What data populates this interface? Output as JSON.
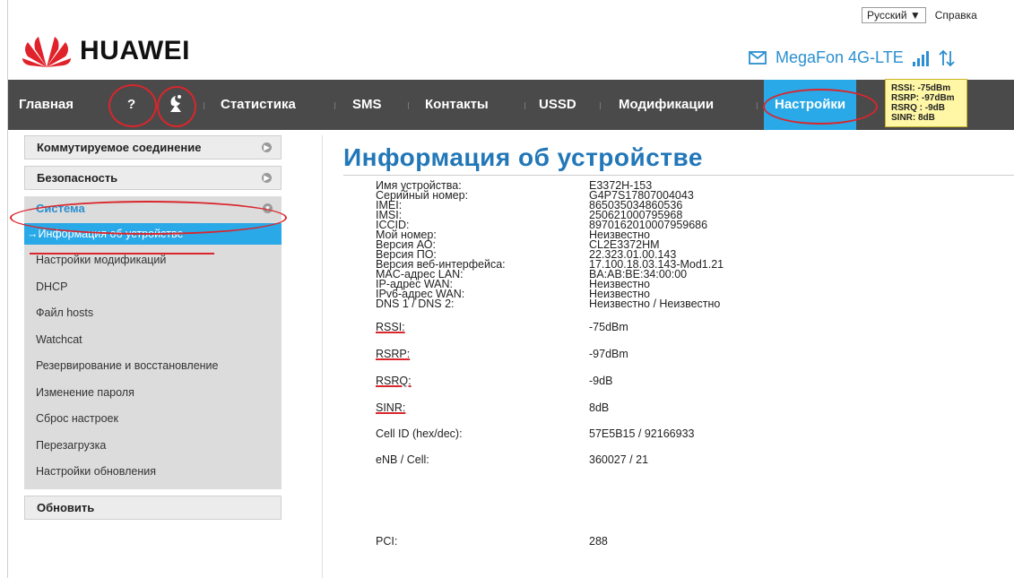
{
  "header": {
    "language": "Русский ▼",
    "help": "Справка",
    "logo_text": "HUAWEI",
    "operator": "MegaFon 4G-LTE",
    "colors": {
      "accent": "#29a9e8",
      "nav_bg": "#4a4a4a",
      "annotation": "#d9262c",
      "title": "#2277b8"
    }
  },
  "nav": {
    "items": [
      "Главная",
      "?",
      "Статистика",
      "SMS",
      "Контакты",
      "USSD",
      "Модификации",
      "Настройки"
    ],
    "active": "Настройки"
  },
  "tooltip": {
    "lines": [
      "RSSI: -75dBm",
      "RSRP: -97dBm",
      "RSRQ : -9dB",
      "SINR: 8dB"
    ]
  },
  "sidebar": {
    "dialup": "Коммутируемое соединение",
    "security": "Безопасность",
    "system": "Система",
    "system_items": [
      "→Информация об устройстве",
      "Настройки модификаций",
      "DHCP",
      "Файл hosts",
      "Watchcat",
      "Резервирование и восстановление",
      "Изменение пароля",
      "Сброс настроек",
      "Перезагрузка",
      "Настройки обновления"
    ],
    "update": "Обновить"
  },
  "content": {
    "title": "Информация об устройстве",
    "rows": [
      {
        "label": "Имя устройства:",
        "value": "E3372H-153"
      },
      {
        "label": "Серийный номер:",
        "value": "G4P7S17807004043"
      },
      {
        "label": "IMEI:",
        "value": "865035034860536"
      },
      {
        "label": "IMSI:",
        "value": "250621000795968"
      },
      {
        "label": "ICCID:",
        "value": "8970162010007959686"
      },
      {
        "label": "Мой номер:",
        "value": "Неизвестно"
      },
      {
        "label": "Версия АО:",
        "value": "CL2E3372HM"
      },
      {
        "label": "Версия ПО:",
        "value": "22.323.01.00.143"
      },
      {
        "label": "Версия веб-интерфейса:",
        "value": "17.100.18.03.143-Mod1.21"
      },
      {
        "label": "MAC-адрес LAN:",
        "value": "BA:AB:BE:34:00:00"
      },
      {
        "label": "IP-адрес WAN:",
        "value": "Неизвестно"
      },
      {
        "label": "IPv6-адрес WAN:",
        "value": "Неизвестно"
      },
      {
        "label": "DNS 1 / DNS 2:",
        "value": "Неизвестно / Неизвестно"
      },
      {
        "label": "RSSI:",
        "value": "-75dBm"
      },
      {
        "label": "RSRP:",
        "value": "-97dBm"
      },
      {
        "label": "RSRQ:",
        "value": "-9dB"
      },
      {
        "label": "SINR:",
        "value": "8dB"
      },
      {
        "label": "Cell ID (hex/dec):",
        "value": "57E5B15 / 92166933"
      },
      {
        "label": "eNB / Cell:",
        "value": "360027 / 21"
      },
      {
        "label": "PCI:",
        "value": "288"
      }
    ]
  }
}
